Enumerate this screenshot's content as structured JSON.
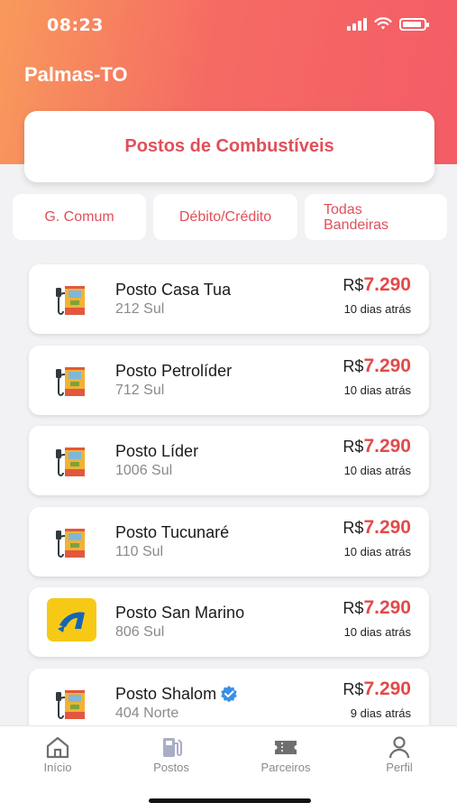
{
  "status_bar": {
    "time": "08:23"
  },
  "header": {
    "city": "Palmas-TO"
  },
  "category": {
    "label": "Postos de Combustíveis"
  },
  "filters": {
    "fuel": "G. Comum",
    "payment": "Débito/Crédito",
    "flag_line1": "Todas",
    "flag_line2": "Bandeiras"
  },
  "colors": {
    "accent": "#e0505a",
    "price": "#e24a4a",
    "header_start": "#f89a5c",
    "header_end": "#f45c66"
  },
  "stations": [
    {
      "name": "Posto Casa Tua",
      "address": "212 Sul",
      "currency": "R$",
      "price": "7.290",
      "updated": "10 dias atrás",
      "logo": "fuel-pump-icon",
      "verified": false
    },
    {
      "name": "Posto Petrolíder",
      "address": "712 Sul",
      "currency": "R$",
      "price": "7.290",
      "updated": "10 dias atrás",
      "logo": "fuel-pump-icon",
      "verified": false
    },
    {
      "name": "Posto Líder",
      "address": "1006 Sul",
      "currency": "R$",
      "price": "7.290",
      "updated": "10 dias atrás",
      "logo": "fuel-pump-icon",
      "verified": false
    },
    {
      "name": "Posto Tucunaré",
      "address": "110 Sul",
      "currency": "R$",
      "price": "7.290",
      "updated": "10 dias atrás",
      "logo": "fuel-pump-icon",
      "verified": false
    },
    {
      "name": "Posto San Marino",
      "address": "806 Sul",
      "currency": "R$",
      "price": "7.290",
      "updated": "10 dias atrás",
      "logo": "ipiranga-logo-icon",
      "verified": false
    },
    {
      "name": "Posto Shalom",
      "address": "404 Norte",
      "currency": "R$",
      "price": "7.290",
      "updated": "9 dias atrás",
      "logo": "fuel-pump-icon",
      "verified": true
    }
  ],
  "tabs": [
    {
      "label": "Início",
      "icon": "home-icon"
    },
    {
      "label": "Postos",
      "icon": "fuel-station-icon"
    },
    {
      "label": "Parceiros",
      "icon": "ticket-icon"
    },
    {
      "label": "Perfil",
      "icon": "person-icon"
    }
  ]
}
